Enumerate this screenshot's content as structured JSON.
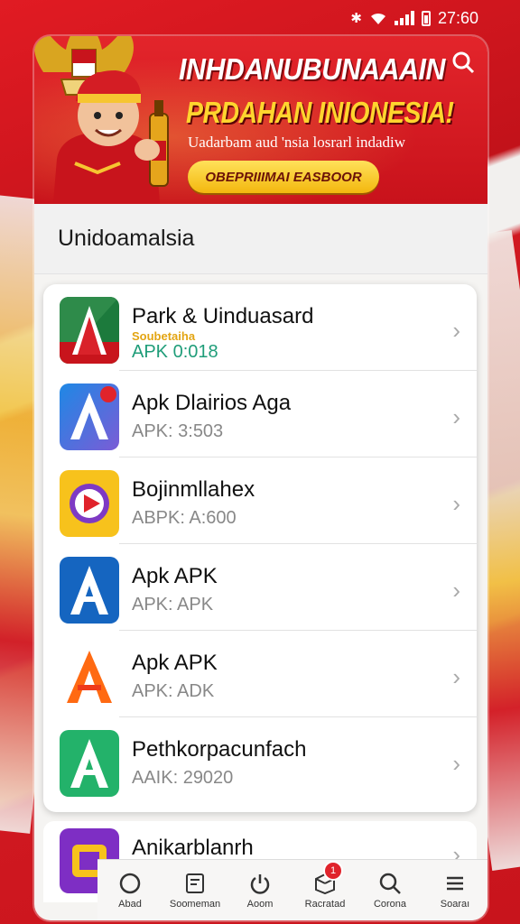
{
  "status_bar": {
    "time": "27:60"
  },
  "banner": {
    "title": "INHDANUBUNAAAIN",
    "subtitle": "PRDAHAN INIONESIA!",
    "tagline": "Uadarbam aud 'nsia losrarl indadiw",
    "cta_label": "OBEPRIIIMAI EASBOOR"
  },
  "section": {
    "title": "Unidoamalsia"
  },
  "apps": [
    {
      "name": "Park & Uinduasard",
      "badge_text": "Soubetaiha",
      "meta": "APK 0:018",
      "icon": "letter-a-red-green-icon",
      "colors": [
        "#1c7a3c",
        "#d9222a"
      ]
    },
    {
      "name": "Apk Dlairios Aga",
      "meta": "APK: 3:503",
      "icon": "letter-a-blue-icon",
      "colors": [
        "#1e88e5",
        "#7b5cd6"
      ]
    },
    {
      "name": "Bojinmllahex",
      "meta": "ABPK: A:600",
      "icon": "play-button-icon",
      "colors": [
        "#f7c21c",
        "#7e3ac4"
      ]
    },
    {
      "name": "Apk APK",
      "meta": "APK: APK",
      "icon": "letter-a-blue-icon",
      "colors": [
        "#1565c0",
        "#1e88e5"
      ]
    },
    {
      "name": "Apk APK",
      "meta": "APK: ADK",
      "icon": "letter-a-orange-icon",
      "colors": [
        "#ff7a1a",
        "#ef3a1a"
      ]
    },
    {
      "name": "Pethkorpacunfach",
      "meta": "AAIK: 29020",
      "icon": "letter-a-green-icon",
      "colors": [
        "#23b26a",
        "#15a050"
      ]
    }
  ],
  "partial_app": {
    "name": "Anikarblanrh",
    "icon": "chip-purple-icon"
  },
  "nav": [
    {
      "label": "Abad",
      "icon": "circle-icon"
    },
    {
      "label": "Soomeman",
      "icon": "document-icon"
    },
    {
      "label": "Aoom",
      "icon": "power-icon"
    },
    {
      "label": "Racratad",
      "icon": "box-icon",
      "badge": "1"
    },
    {
      "label": "Corona",
      "icon": "search-icon"
    },
    {
      "label": "Soaraı",
      "icon": "menu-icon"
    }
  ],
  "colors": {
    "brand_red": "#c8141c",
    "accent_yellow": "#ffd52e",
    "app_green": "#1f9d79"
  }
}
